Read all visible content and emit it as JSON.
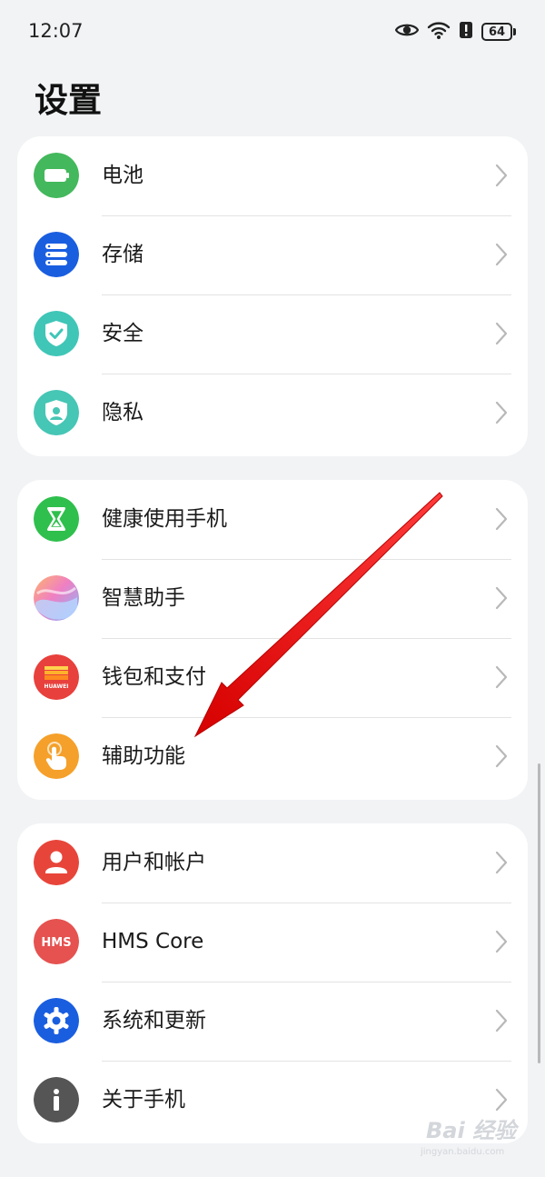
{
  "status_bar": {
    "time": "12:07",
    "battery": "64",
    "icons": [
      "eye-comfort-icon",
      "wifi-icon",
      "alert-icon",
      "battery-icon"
    ]
  },
  "page_title": "设置",
  "groups": [
    {
      "items": [
        {
          "label": "电池",
          "icon": "battery-icon",
          "color": "#43b85c"
        },
        {
          "label": "存储",
          "icon": "storage-icon",
          "color": "#1a5ee0"
        },
        {
          "label": "安全",
          "icon": "shield-check-icon",
          "color": "#3fc6b7"
        },
        {
          "label": "隐私",
          "icon": "privacy-shield-icon",
          "color": "#46c6b5"
        }
      ]
    },
    {
      "items": [
        {
          "label": "健康使用手机",
          "icon": "hourglass-icon",
          "color": "#2fbf4d"
        },
        {
          "label": "智慧助手",
          "icon": "assistant-icon",
          "color": "#c88fe0"
        },
        {
          "label": "钱包和支付",
          "icon": "wallet-icon",
          "color": "#e8403c",
          "brand": "HUAWEI"
        },
        {
          "label": "辅助功能",
          "icon": "hand-pointer-icon",
          "color": "#f5a02a"
        }
      ]
    },
    {
      "items": [
        {
          "label": "用户和帐户",
          "icon": "user-icon",
          "color": "#e8453a"
        },
        {
          "label": "HMS Core",
          "icon": "hms-icon",
          "color": "#e55250",
          "brand": "HMS"
        },
        {
          "label": "系统和更新",
          "icon": "gear-icon",
          "color": "#1a5ee0"
        },
        {
          "label": "关于手机",
          "icon": "info-icon",
          "color": "#555555"
        }
      ]
    }
  ],
  "watermark": {
    "text": "Bai 经验",
    "sub": "jingyan.baidu.com"
  }
}
